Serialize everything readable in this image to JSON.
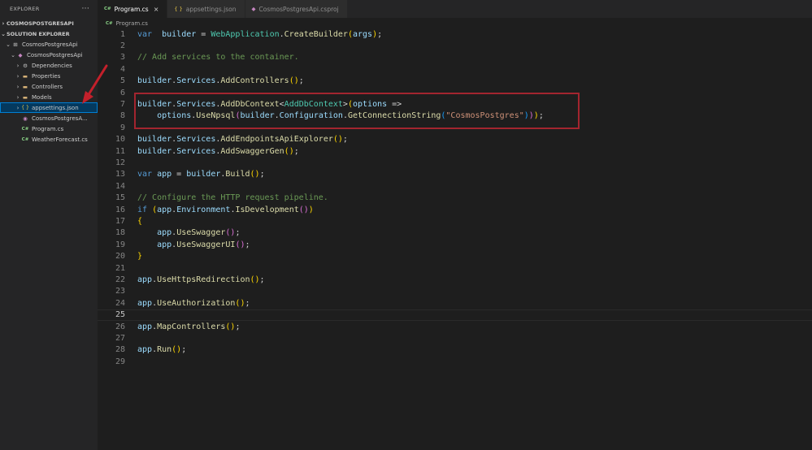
{
  "sidebar": {
    "header": "EXPLORER",
    "more": "···",
    "section1": "COSMOSPOSTGRESAPI",
    "section2": "SOLUTION EXPLORER",
    "tree": [
      {
        "label": "CosmosPostgresApi",
        "indent": 1,
        "chev": "⌄",
        "icon": "solution"
      },
      {
        "label": "CosmosPostgresApi",
        "indent": 2,
        "chev": "⌄",
        "icon": "project"
      },
      {
        "label": "Dependencies",
        "indent": 3,
        "chev": "›",
        "icon": "dependencies"
      },
      {
        "label": "Properties",
        "indent": 3,
        "chev": "›",
        "icon": "folder"
      },
      {
        "label": "Controllers",
        "indent": 3,
        "chev": "›",
        "icon": "folder"
      },
      {
        "label": "Models",
        "indent": 3,
        "chev": "›",
        "icon": "folder"
      },
      {
        "label": "appsettings.json",
        "indent": 3,
        "chev": "›",
        "icon": "json",
        "selected": true
      },
      {
        "label": "CosmosPostgresA...",
        "indent": 3,
        "chev": "",
        "icon": "project-file"
      },
      {
        "label": "Program.cs",
        "indent": 3,
        "chev": "",
        "icon": "csharp"
      },
      {
        "label": "WeatherForecast.cs",
        "indent": 3,
        "chev": "",
        "icon": "csharp"
      }
    ]
  },
  "tabs": [
    {
      "label": "Program.cs",
      "icon_text": "C#",
      "active": true,
      "close": "×"
    },
    {
      "label": "appsettings.json",
      "icon_text": "{ }",
      "active": false
    },
    {
      "label": "CosmosPostgresApi.csproj",
      "icon_text": "◆",
      "active": false
    }
  ],
  "breadcrumb": {
    "icon_text": "C#",
    "label": "Program.cs"
  },
  "editor": {
    "current_line": 25,
    "lines": [
      [
        [
          "kw",
          "var"
        ],
        [
          "",
          "  "
        ],
        [
          "vr",
          "builder"
        ],
        [
          "",
          " = "
        ],
        [
          "cl",
          "WebApplication"
        ],
        [
          "",
          "."
        ],
        [
          "fn",
          "CreateBuilder"
        ],
        [
          "pa",
          "("
        ],
        [
          "vr",
          "args"
        ],
        [
          "pa",
          ")"
        ],
        [
          "",
          ";"
        ]
      ],
      [],
      [
        [
          "cm",
          "// Add services to the container."
        ]
      ],
      [],
      [
        [
          "vr",
          "builder"
        ],
        [
          "",
          "."
        ],
        [
          "vr",
          "Services"
        ],
        [
          "",
          "."
        ],
        [
          "fn",
          "AddControllers"
        ],
        [
          "pa",
          "()"
        ],
        [
          "",
          ";"
        ]
      ],
      [],
      [
        [
          "vr",
          "builder"
        ],
        [
          "",
          "."
        ],
        [
          "vr",
          "Services"
        ],
        [
          "",
          "."
        ],
        [
          "fn",
          "AddDbContext"
        ],
        [
          "",
          "<"
        ],
        [
          "cl",
          "AddDbContext"
        ],
        [
          "",
          ">"
        ],
        [
          "pa",
          "("
        ],
        [
          "vr",
          "options"
        ],
        [
          "",
          " =>"
        ]
      ],
      [
        [
          "",
          "    "
        ],
        [
          "vr",
          "options"
        ],
        [
          "",
          "."
        ],
        [
          "fn",
          "UseNpsql"
        ],
        [
          "pb",
          "("
        ],
        [
          "vr",
          "builder"
        ],
        [
          "",
          "."
        ],
        [
          "vr",
          "Configuration"
        ],
        [
          "",
          "."
        ],
        [
          "fn",
          "GetConnectionString"
        ],
        [
          "pc",
          "("
        ],
        [
          "str",
          "\"CosmosPostgres\""
        ],
        [
          "pc",
          ")"
        ],
        [
          "pb",
          ")"
        ],
        [
          "pa",
          ")"
        ],
        [
          "",
          ";"
        ]
      ],
      [],
      [
        [
          "vr",
          "builder"
        ],
        [
          "",
          "."
        ],
        [
          "vr",
          "Services"
        ],
        [
          "",
          "."
        ],
        [
          "fn",
          "AddEndpointsApiExplorer"
        ],
        [
          "pa",
          "()"
        ],
        [
          "",
          ";"
        ]
      ],
      [
        [
          "vr",
          "builder"
        ],
        [
          "",
          "."
        ],
        [
          "vr",
          "Services"
        ],
        [
          "",
          "."
        ],
        [
          "fn",
          "AddSwaggerGen"
        ],
        [
          "pa",
          "()"
        ],
        [
          "",
          ";"
        ]
      ],
      [],
      [
        [
          "kw",
          "var"
        ],
        [
          "",
          " "
        ],
        [
          "vr",
          "app"
        ],
        [
          "",
          " = "
        ],
        [
          "vr",
          "builder"
        ],
        [
          "",
          "."
        ],
        [
          "fn",
          "Build"
        ],
        [
          "pa",
          "()"
        ],
        [
          "",
          ";"
        ]
      ],
      [],
      [
        [
          "cm",
          "// Configure the HTTP request pipeline."
        ]
      ],
      [
        [
          "kw",
          "if"
        ],
        [
          "",
          " "
        ],
        [
          "pa",
          "("
        ],
        [
          "vr",
          "app"
        ],
        [
          "",
          "."
        ],
        [
          "vr",
          "Environment"
        ],
        [
          "",
          "."
        ],
        [
          "fn",
          "IsDevelopment"
        ],
        [
          "pb",
          "()"
        ],
        [
          "pa",
          ")"
        ]
      ],
      [
        [
          "pa",
          "{"
        ]
      ],
      [
        [
          "",
          "    "
        ],
        [
          "vr",
          "app"
        ],
        [
          "",
          "."
        ],
        [
          "fn",
          "UseSwagger"
        ],
        [
          "pb",
          "()"
        ],
        [
          "",
          ";"
        ]
      ],
      [
        [
          "",
          "    "
        ],
        [
          "vr",
          "app"
        ],
        [
          "",
          "."
        ],
        [
          "fn",
          "UseSwaggerUI"
        ],
        [
          "pb",
          "()"
        ],
        [
          "",
          ";"
        ]
      ],
      [
        [
          "pa",
          "}"
        ]
      ],
      [],
      [
        [
          "vr",
          "app"
        ],
        [
          "",
          "."
        ],
        [
          "fn",
          "UseHttpsRedirection"
        ],
        [
          "pa",
          "()"
        ],
        [
          "",
          ";"
        ]
      ],
      [],
      [
        [
          "vr",
          "app"
        ],
        [
          "",
          "."
        ],
        [
          "fn",
          "UseAuthorization"
        ],
        [
          "pa",
          "()"
        ],
        [
          "",
          ";"
        ]
      ],
      [],
      [
        [
          "vr",
          "app"
        ],
        [
          "",
          "."
        ],
        [
          "fn",
          "MapControllers"
        ],
        [
          "pa",
          "()"
        ],
        [
          "",
          ";"
        ]
      ],
      [],
      [
        [
          "vr",
          "app"
        ],
        [
          "",
          "."
        ],
        [
          "fn",
          "Run"
        ],
        [
          "pa",
          "()"
        ],
        [
          "",
          ";"
        ]
      ],
      []
    ]
  },
  "colors": {
    "background": "#1e1e1e",
    "sidebar": "#252526",
    "selection": "#04395e",
    "highlight_box": "#a3252f",
    "arrow": "#c4202b"
  }
}
